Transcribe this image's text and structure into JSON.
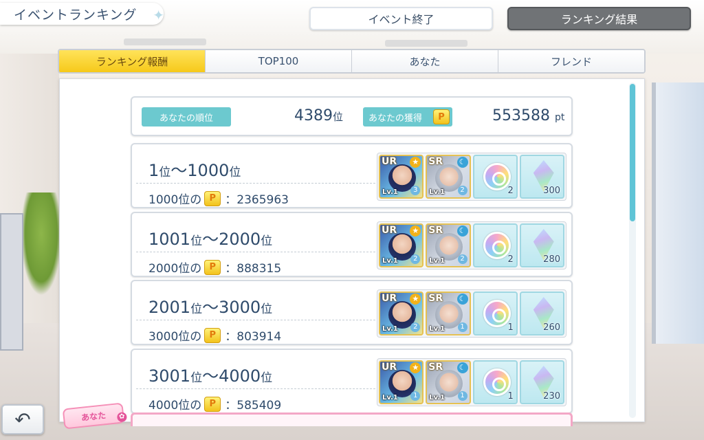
{
  "header": {
    "title": "イベントランキング",
    "event_end_label": "イベント終了",
    "ranking_result_label": "ランキング結果"
  },
  "tabs": [
    {
      "label": "ランキング報酬",
      "active": true
    },
    {
      "label": "TOP100",
      "active": false
    },
    {
      "label": "あなた",
      "active": false
    },
    {
      "label": "フレンド",
      "active": false
    }
  ],
  "summary": {
    "rank_label": "あなたの順位",
    "rank_value": "4389",
    "rank_unit": "位",
    "earn_label": "あなたの獲得",
    "points_value": "553588",
    "points_unit": "pt"
  },
  "point_icon": "P",
  "rewards_rows": [
    {
      "range_from": "1",
      "range_to": "1000",
      "border_rank": "1000位の",
      "border_points": "：2365963",
      "items": [
        {
          "type": "ur",
          "rarity": "UR",
          "lv": "Lv.1",
          "qty": "3",
          "icon": "ur-card-icon"
        },
        {
          "type": "sr",
          "rarity": "SR",
          "lv": "Lv.1",
          "qty": "2",
          "icon": "sr-card-icon"
        },
        {
          "type": "coin",
          "qty": "2",
          "icon": "coin-icon"
        },
        {
          "type": "gem",
          "qty": "300",
          "icon": "gem-icon"
        }
      ]
    },
    {
      "range_from": "1001",
      "range_to": "2000",
      "border_rank": "2000位の",
      "border_points": "：888315",
      "items": [
        {
          "type": "ur",
          "rarity": "UR",
          "lv": "Lv.1",
          "qty": "2",
          "icon": "ur-card-icon"
        },
        {
          "type": "sr",
          "rarity": "SR",
          "lv": "Lv.1",
          "qty": "2",
          "icon": "sr-card-icon"
        },
        {
          "type": "coin",
          "qty": "2",
          "icon": "coin-icon"
        },
        {
          "type": "gem",
          "qty": "280",
          "icon": "gem-icon"
        }
      ]
    },
    {
      "range_from": "2001",
      "range_to": "3000",
      "border_rank": "3000位の",
      "border_points": "：803914",
      "items": [
        {
          "type": "ur",
          "rarity": "UR",
          "lv": "Lv.1",
          "qty": "2",
          "icon": "ur-card-icon"
        },
        {
          "type": "sr",
          "rarity": "SR",
          "lv": "Lv.1",
          "qty": "1",
          "icon": "sr-card-icon"
        },
        {
          "type": "coin",
          "qty": "1",
          "icon": "coin-icon"
        },
        {
          "type": "gem",
          "qty": "260",
          "icon": "gem-icon"
        }
      ]
    },
    {
      "range_from": "3001",
      "range_to": "4000",
      "border_rank": "4000位の",
      "border_points": "：585409",
      "items": [
        {
          "type": "ur",
          "rarity": "UR",
          "lv": "Lv.1",
          "qty": "1",
          "icon": "ur-card-icon"
        },
        {
          "type": "sr",
          "rarity": "SR",
          "lv": "Lv.1",
          "qty": "1",
          "icon": "sr-card-icon"
        },
        {
          "type": "coin",
          "qty": "1",
          "icon": "coin-icon"
        },
        {
          "type": "gem",
          "qty": "230",
          "icon": "gem-icon"
        }
      ]
    }
  ],
  "range_unit": "位",
  "range_sep": "～",
  "you_badge_label": "あなた",
  "back_icon": "back-arrow-icon",
  "colors": {
    "accent": "#f6c91a",
    "teal": "#6cc9cf",
    "text": "#2f4b6b"
  }
}
